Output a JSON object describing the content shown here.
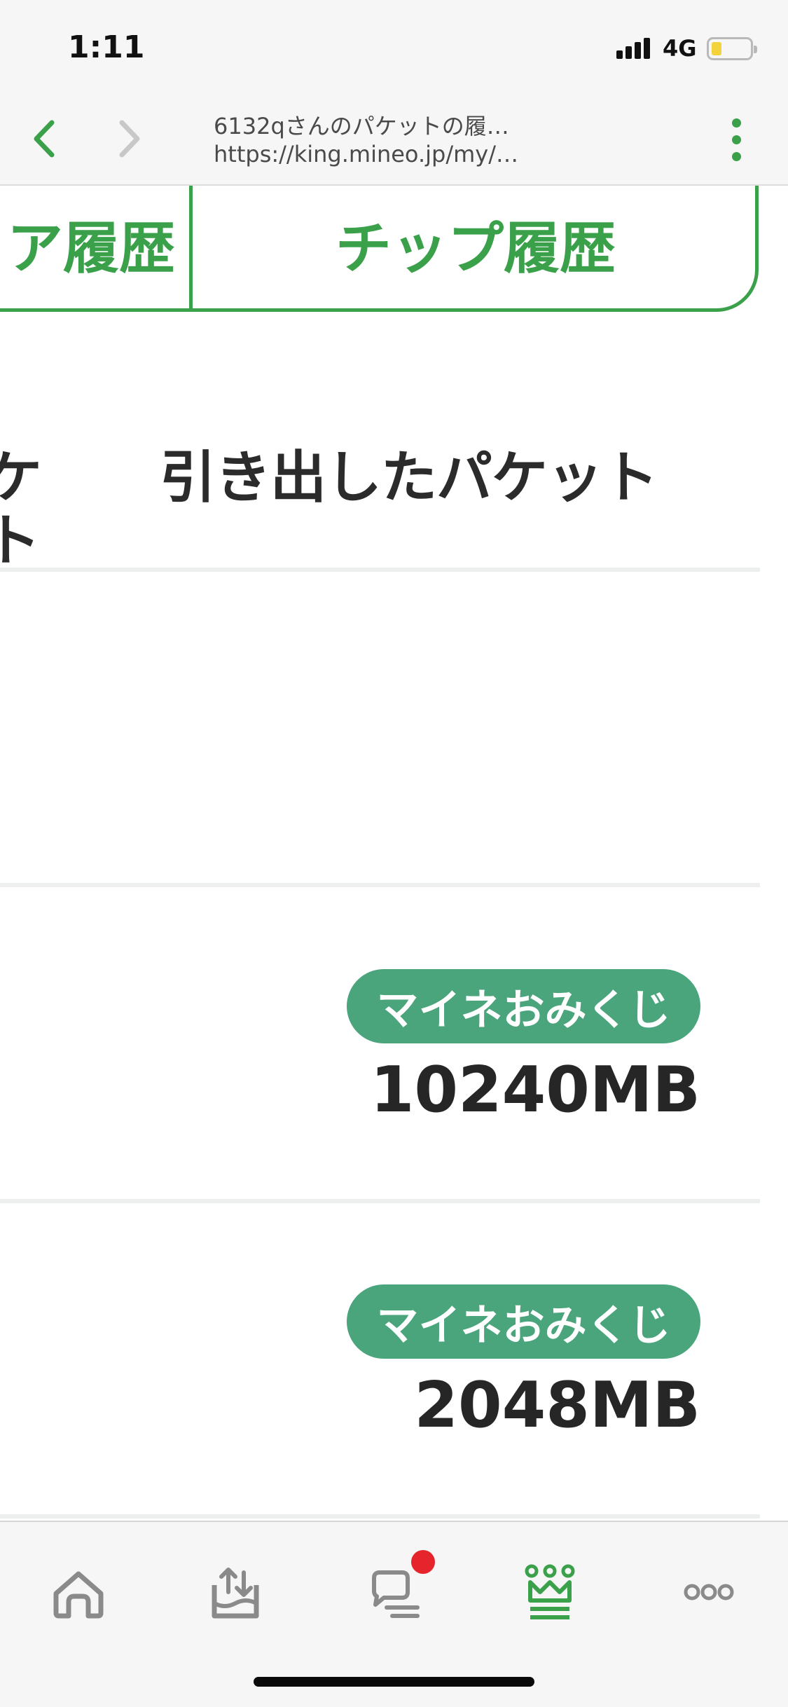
{
  "status_bar": {
    "time": "1:11",
    "network": "4G"
  },
  "browser": {
    "page_title": "6132qさんのパケットの履…",
    "url": "https://king.mineo.jp/my/…"
  },
  "tabs": {
    "left_label": "ア履歴",
    "right_label": "チップ履歴"
  },
  "table": {
    "header_left_line1": "ケ",
    "header_left_line2": "ト",
    "header_right": "引き出したパケット",
    "rows": [
      {
        "badge": "マイネおみくじ",
        "amount": "10240MB"
      },
      {
        "badge": "マイネおみくじ",
        "amount": "2048MB"
      }
    ]
  },
  "colors": {
    "accent_green": "#3aa14a",
    "badge_green": "#4aa57c",
    "notification_red": "#e5242c"
  },
  "icons": {
    "back": "chevron-left-icon",
    "forward": "chevron-right-icon",
    "menu": "kebab-menu-icon",
    "tab_home": "home-icon",
    "tab_upload": "tray-upload-icon",
    "tab_chat": "chat-bubble-icon",
    "tab_king": "crown-icon",
    "tab_more": "more-dots-icon"
  }
}
